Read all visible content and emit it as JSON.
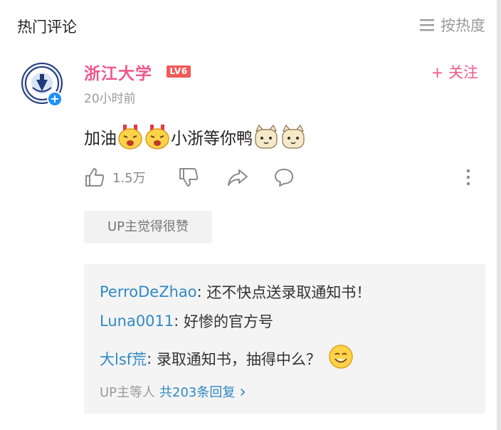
{
  "header": {
    "title": "热门评论",
    "sort_label": "按热度"
  },
  "comment": {
    "username": "浙江大学",
    "level": "LV6",
    "follow_label": "+ 关注",
    "time": "20小时前",
    "content": {
      "text1": "加油",
      "text2": "小浙等你鸭"
    },
    "like_count": "1.5万",
    "up_liked_label": "UP主觉得很赞"
  },
  "replies": [
    {
      "user": "PerroDeZhao",
      "sep": ": ",
      "text": "还不快点送录取通知书！"
    },
    {
      "user": "Luna0011",
      "sep": ": ",
      "text": "好惨的官方号"
    },
    {
      "user": "大lsf荒",
      "sep": ": ",
      "text": "录取通知书，抽得中么？"
    }
  ],
  "reply_footer": {
    "prefix": "UP主等人",
    "count_text": "共203条回复",
    "arrow": "›"
  },
  "colors": {
    "accent_pink": "#f0588d",
    "reply_user_blue": "#2f89c5",
    "level_badge": "#f05a5a"
  }
}
